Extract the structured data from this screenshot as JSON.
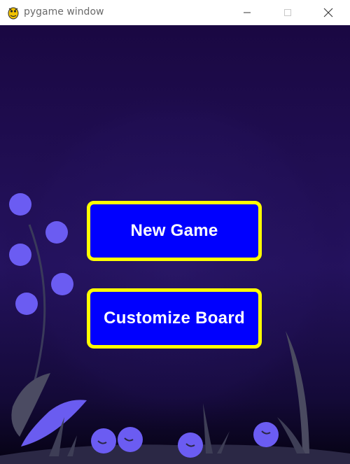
{
  "window": {
    "title": "pygame window",
    "minimize_glyph": "—",
    "maximize_glyph": "☐",
    "close_glyph": "✕"
  },
  "menu": {
    "new_game_label": "New Game",
    "customize_board_label": "Customize Board"
  },
  "colors": {
    "button_fill": "#0000ff",
    "button_border": "#ffff00",
    "button_text": "#ffffff",
    "background_top": "#1a0842",
    "background_bottom": "#050212",
    "berry": "#6b5cf2"
  },
  "icons": {
    "app": "pygame-snake-icon",
    "minimize": "minimize-icon",
    "maximize": "maximize-icon",
    "close": "close-icon"
  }
}
